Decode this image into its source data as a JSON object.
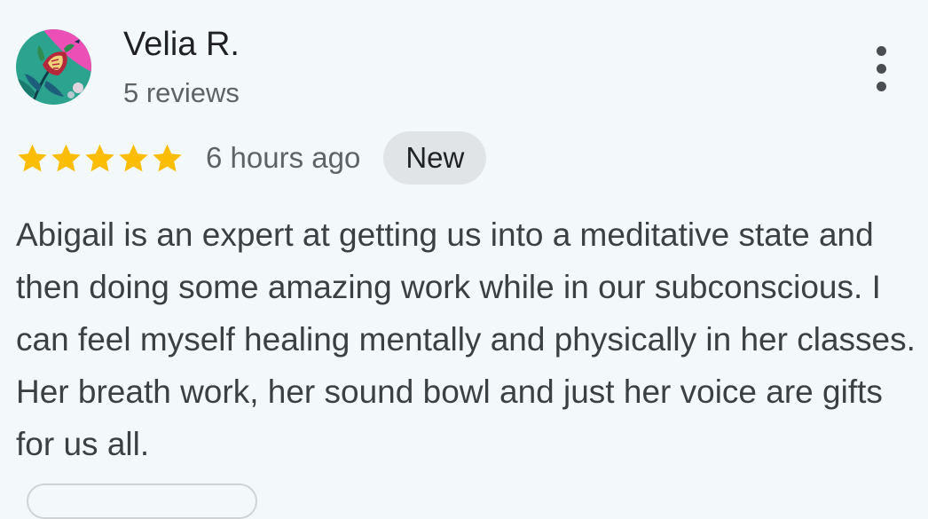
{
  "reviewer": {
    "name": "Velia R.",
    "meta": "5 reviews",
    "avatar_icon": "floral-avatar-icon"
  },
  "review": {
    "rating": 5,
    "rating_max": 5,
    "time": "6 hours ago",
    "badge": "New",
    "text": "Abigail is an expert at getting us into a meditative state and then doing some amazing work while in our subconscious. I can feel myself healing mentally and physically in her classes. Her breath work, her sound bowl and just her voice are gifts for us all."
  },
  "actions": {
    "more_icon": "more-vert-icon"
  },
  "colors": {
    "background": "#f3f9fa",
    "star": "#fbbc04",
    "badge_bg": "#e1e4e7",
    "secondary_text": "#5f6368"
  }
}
